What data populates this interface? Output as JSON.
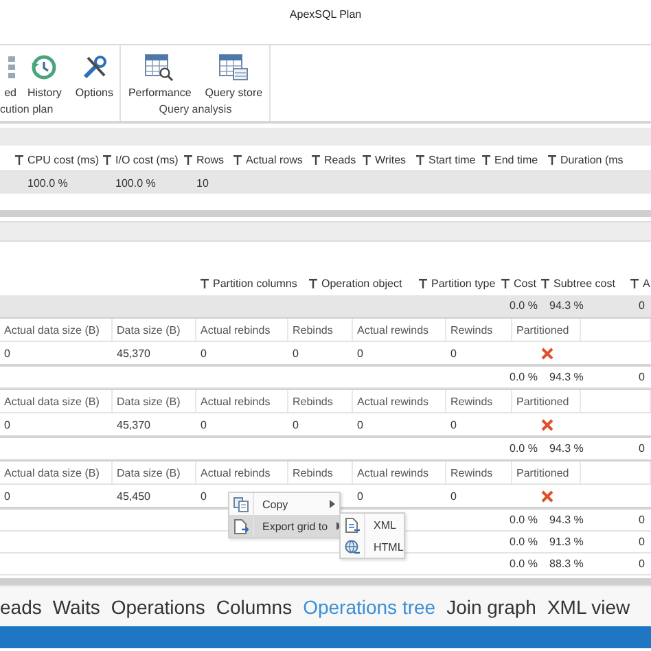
{
  "window": {
    "title": "ApexSQL Plan"
  },
  "ribbon": {
    "groups": [
      {
        "label": "cution plan",
        "buttons": [
          {
            "label": "ed"
          },
          {
            "label": "History"
          },
          {
            "label": "Options"
          }
        ]
      },
      {
        "label": "Query analysis",
        "buttons": [
          {
            "label": "Performance"
          },
          {
            "label": "Query store"
          }
        ]
      }
    ]
  },
  "top_grid": {
    "columns": [
      "CPU cost (ms)",
      "I/O cost (ms)",
      "Rows",
      "Actual rows",
      "Reads",
      "Writes",
      "Start time",
      "End time",
      "Duration (ms"
    ],
    "rows": [
      {
        "selected": true,
        "cells": [
          "100.0 %",
          "100.0 %",
          "10"
        ]
      }
    ]
  },
  "operations_grid": {
    "columns": [
      "Partition columns",
      "Operation object",
      "Partition type",
      "Cost",
      "Subtree cost",
      "A"
    ],
    "rows": [
      {
        "kind": "summary",
        "selected": true,
        "cost": "0.0 %",
        "subtree_cost": "94.3 %",
        "column_6": "0"
      },
      {
        "kind": "detail",
        "columns": [
          "Actual data size (B)",
          "Data size (B)",
          "Actual rebinds",
          "Rebinds",
          "Actual rewinds",
          "Rewinds",
          "Partitioned"
        ],
        "values": {
          "actual_data_size": "0",
          "data_size": "45,370",
          "actual_rebinds": "0",
          "rebinds": "0",
          "actual_rewinds": "0",
          "rewinds": "0"
        },
        "partitioned": false
      },
      {
        "kind": "summary",
        "selected": false,
        "cost": "0.0 %",
        "subtree_cost": "94.3 %",
        "column_6": "0"
      },
      {
        "kind": "detail",
        "columns": [
          "Actual data size (B)",
          "Data size (B)",
          "Actual rebinds",
          "Rebinds",
          "Actual rewinds",
          "Rewinds",
          "Partitioned"
        ],
        "values": {
          "actual_data_size": "0",
          "data_size": "45,370",
          "actual_rebinds": "0",
          "rebinds": "0",
          "actual_rewinds": "0",
          "rewinds": "0"
        },
        "partitioned": false
      },
      {
        "kind": "summary",
        "selected": false,
        "cost": "0.0 %",
        "subtree_cost": "94.3 %",
        "column_6": "0"
      },
      {
        "kind": "detail",
        "columns": [
          "Actual data size (B)",
          "Data size (B)",
          "Actual rebinds",
          "Rebinds",
          "Actual rewinds",
          "Rewinds",
          "Partitioned"
        ],
        "values": {
          "actual_data_size": "0",
          "data_size": "45,450",
          "actual_rebinds": "0",
          "actual_rewinds": "0",
          "rewinds": "0"
        },
        "partitioned": false
      },
      {
        "kind": "summary",
        "selected": false,
        "cost": "0.0 %",
        "subtree_cost": "94.3 %",
        "column_6": "0"
      },
      {
        "kind": "summary",
        "selected": false,
        "cost": "0.0 %",
        "subtree_cost": "91.3 %",
        "column_6": "0"
      },
      {
        "kind": "summary",
        "selected": false,
        "cost": "0.0 %",
        "subtree_cost": "88.3 %",
        "column_6": "0"
      }
    ]
  },
  "context_menu": {
    "items": [
      {
        "label": "Copy",
        "has_submenu": true,
        "selected": false
      },
      {
        "label": "Export grid to",
        "has_submenu": true,
        "selected": true
      }
    ],
    "submenu": [
      {
        "label": "XML"
      },
      {
        "label": "HTML"
      }
    ]
  },
  "tabs": [
    {
      "label": "eads",
      "selected": false
    },
    {
      "label": "Waits",
      "selected": false
    },
    {
      "label": "Operations",
      "selected": false
    },
    {
      "label": "Columns",
      "selected": false
    },
    {
      "label": "Operations tree",
      "selected": true
    },
    {
      "label": "Join graph",
      "selected": false
    },
    {
      "label": "XML view",
      "selected": false
    }
  ]
}
